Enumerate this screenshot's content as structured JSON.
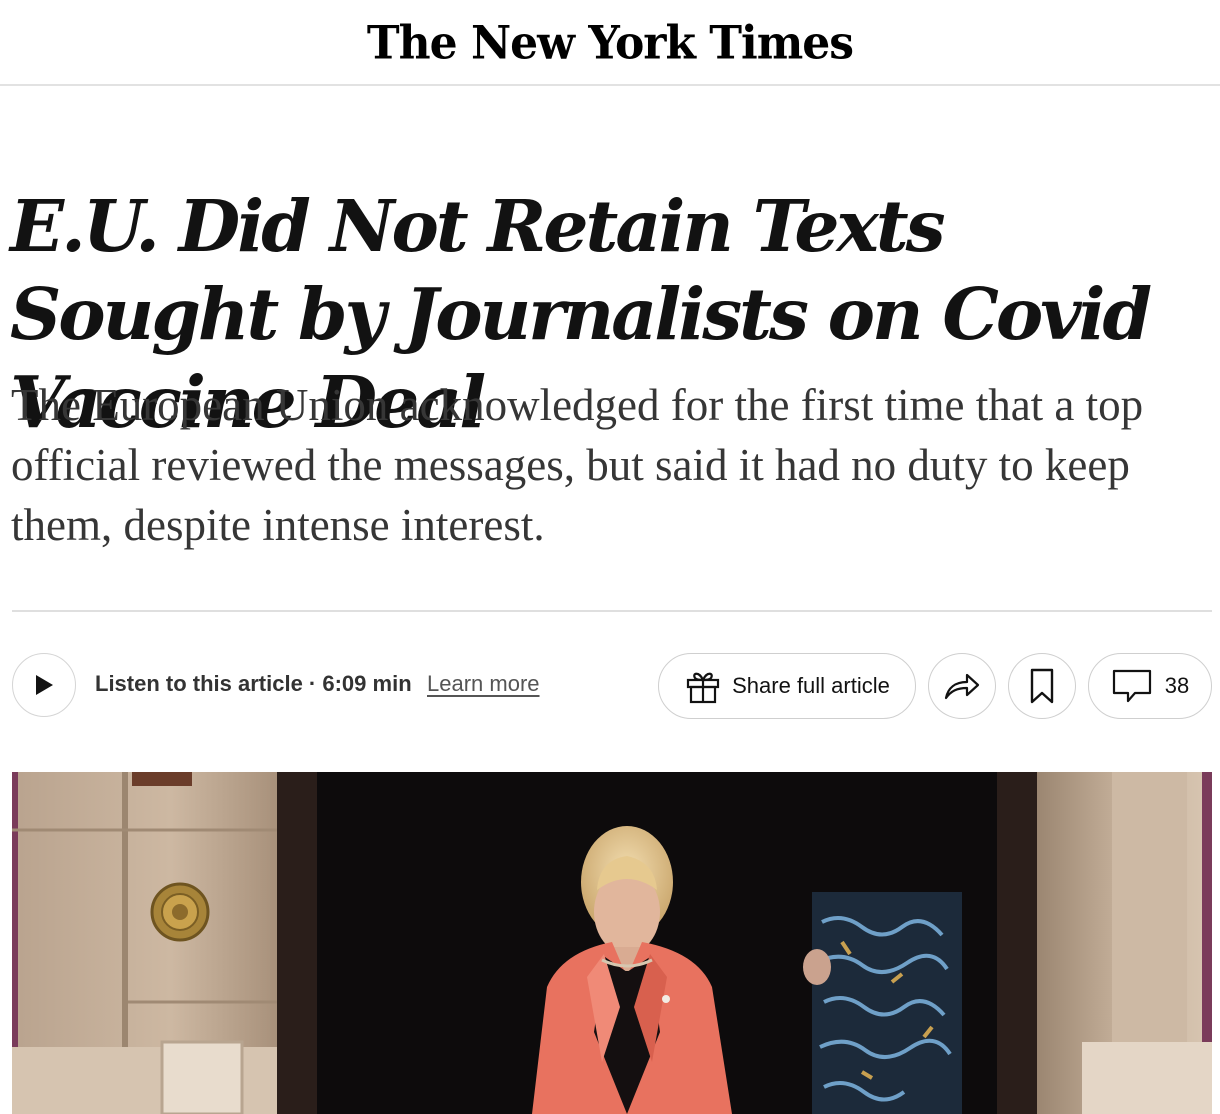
{
  "masthead": {
    "logo_text": "The New York Times"
  },
  "article": {
    "headline": "E.U. Did Not Retain Texts Sought by Journalists on Covid Vaccine Deal",
    "summary": "The European Union acknowledged for the first time that a top official reviewed the messages, but said it had no duty to keep them, despite intense interest."
  },
  "toolbar": {
    "play_icon": "play-icon",
    "listen_label": "Listen to this article · 6:09 min",
    "learn_more_label": "Learn more",
    "share_full_icon": "gift-icon",
    "share_full_label": "Share full article",
    "share_icon": "share-arrow-icon",
    "save_icon": "bookmark-icon",
    "comments_icon": "comment-icon",
    "comments_count": "38"
  },
  "colors": {
    "text": "#121212",
    "summary_text": "#363636",
    "divider": "#dfdfdf",
    "jacket": "#e8725f"
  }
}
